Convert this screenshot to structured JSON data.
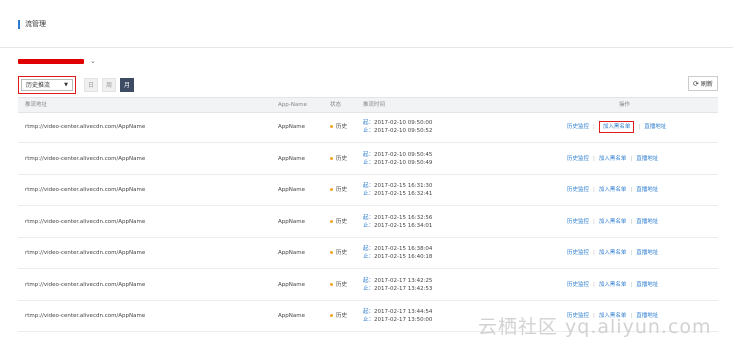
{
  "page": {
    "title": "流管理"
  },
  "toolbar": {
    "history_select": "历史推流",
    "range_buttons": [
      "日",
      "周",
      "月"
    ],
    "refresh": "刷新"
  },
  "table": {
    "columns": [
      "推流地址",
      "App-Name",
      "状态",
      "推流时间",
      "操作"
    ],
    "rows": [
      {
        "address": "rtmp://video-center.alivecdn.com/AppName",
        "app": "AppName",
        "status": "历史",
        "start": "2017-02-10 09:50:00",
        "end": "2017-02-10 09:50:52"
      },
      {
        "address": "rtmp://video-center.alivecdn.com/AppName",
        "app": "AppName",
        "status": "历史",
        "start": "2017-02-10 09:50:45",
        "end": "2017-02-10 09:50:49"
      },
      {
        "address": "rtmp://video-center.alivecdn.com/AppName",
        "app": "AppName",
        "status": "历史",
        "start": "2017-02-15 16:31:30",
        "end": "2017-02-15 16:32:41"
      },
      {
        "address": "rtmp://video-center.alivecdn.com/AppName",
        "app": "AppName",
        "status": "历史",
        "start": "2017-02-15 16:32:56",
        "end": "2017-02-15 16:34:01"
      },
      {
        "address": "rtmp://video-center.alivecdn.com/AppName",
        "app": "AppName",
        "status": "历史",
        "start": "2017-02-15 16:38:04",
        "end": "2017-02-15 16:40:18"
      },
      {
        "address": "rtmp://video-center.alivecdn.com/AppName",
        "app": "AppName",
        "status": "历史",
        "start": "2017-02-17 13:42:25",
        "end": "2017-02-17 13:42:53"
      },
      {
        "address": "rtmp://video-center.alivecdn.com/AppName",
        "app": "AppName",
        "status": "历史",
        "start": "2017-02-17 13:44:54",
        "end": "2017-02-17 13:50:00"
      }
    ],
    "start_label": "起：",
    "end_label": "止：",
    "actions": [
      "历史监控",
      "加入黑名单",
      "直播地址"
    ]
  },
  "watermark": "云栖社区 yq.aliyun.com"
}
